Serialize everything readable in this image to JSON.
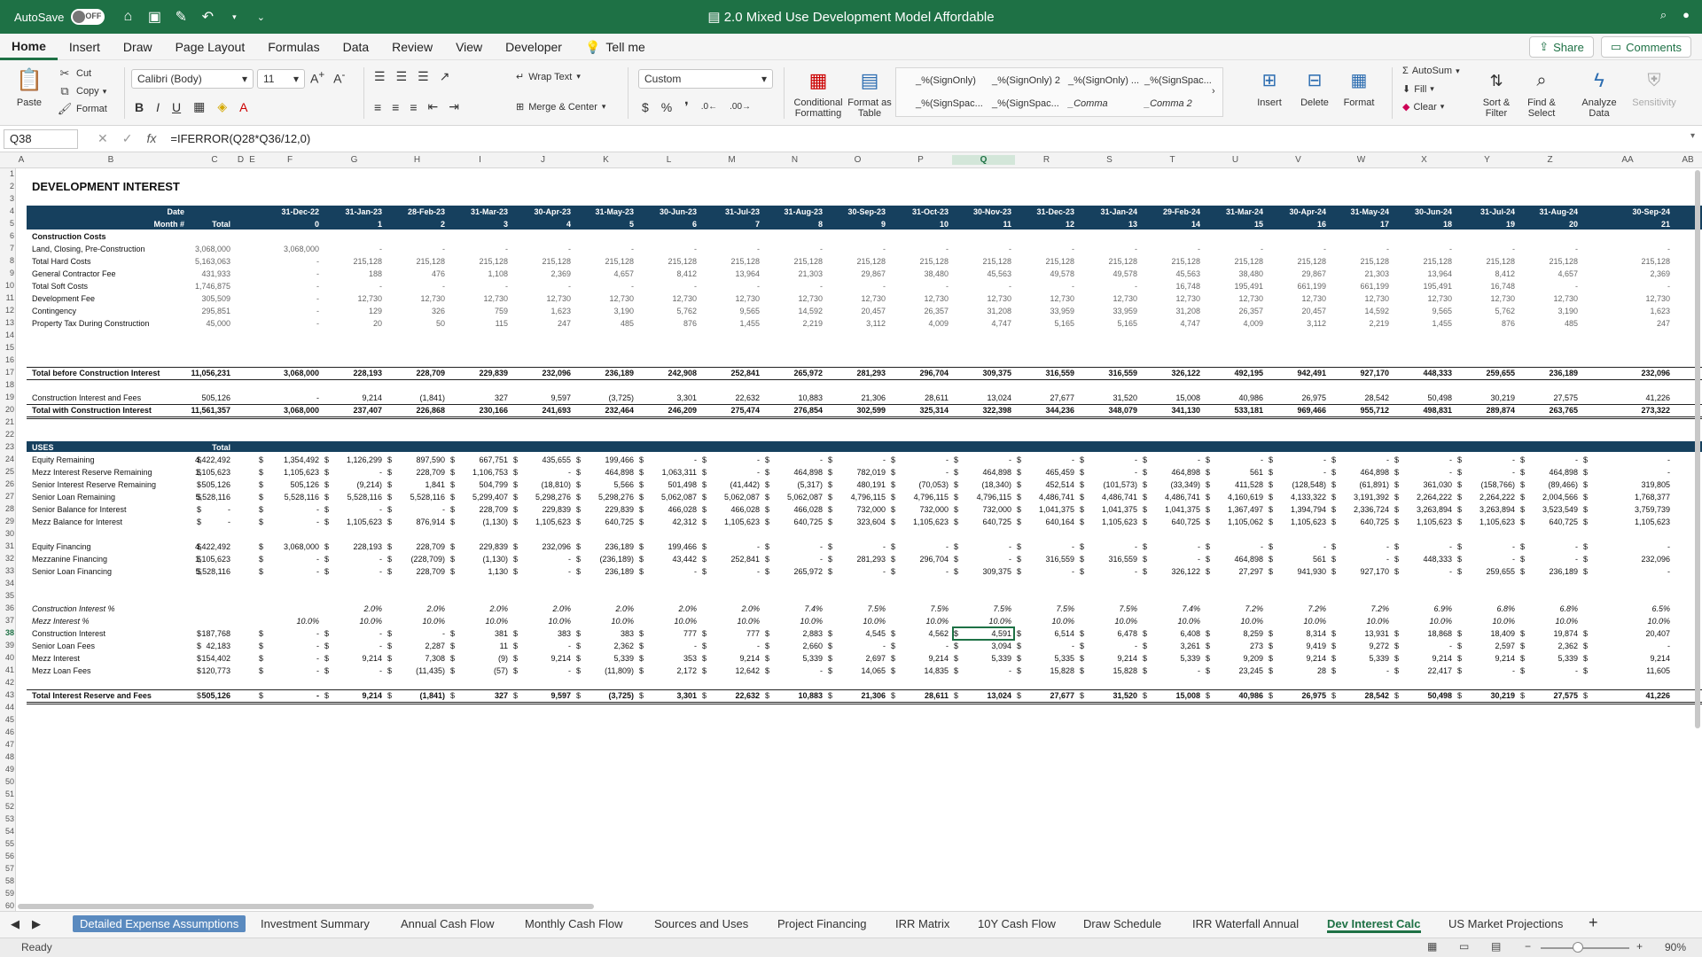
{
  "titlebar": {
    "autosave_label": "AutoSave",
    "toggle_state": "OFF",
    "doc_title": "2.0 Mixed Use Development Model Affordable"
  },
  "menu": {
    "tabs": [
      "Home",
      "Insert",
      "Draw",
      "Page Layout",
      "Formulas",
      "Data",
      "Review",
      "View",
      "Developer"
    ],
    "tell_me": "Tell me",
    "share": "Share",
    "comments": "Comments"
  },
  "ribbon": {
    "paste": "Paste",
    "cut": "Cut",
    "copy": "Copy",
    "format": "Format",
    "font_name": "Calibri (Body)",
    "font_size": "11",
    "wrap_text": "Wrap Text",
    "merge_center": "Merge & Center",
    "number_format": "Custom",
    "conditional_formatting": "Conditional Formatting",
    "format_as_table": "Format as Table",
    "styles": [
      "_%(SignOnly)",
      "_%(SignOnly) 2",
      "_%(SignOnly) ...",
      "_%(SignSpac...",
      "_%(SignSpac...",
      "_%(SignSpac...",
      "_Comma",
      "_Comma 2"
    ],
    "insert": "Insert",
    "delete": "Delete",
    "format_cells": "Format",
    "autosum": "AutoSum",
    "fill": "Fill",
    "clear": "Clear",
    "sort_filter": "Sort & Filter",
    "find_select": "Find & Select",
    "analyze_data": "Analyze Data",
    "sensitivity": "Sensitivity"
  },
  "formula_bar": {
    "name_box": "Q38",
    "fx": "fx",
    "formula": "=IFERROR(Q28*Q36/12,0)"
  },
  "columns": [
    "A",
    "B",
    "C",
    "D",
    "E",
    "F",
    "G",
    "H",
    "I",
    "J",
    "K",
    "L",
    "M",
    "N",
    "O",
    "P",
    "Q",
    "R",
    "S",
    "T",
    "U",
    "V",
    "W",
    "X",
    "Y",
    "Z",
    "AA",
    "AB"
  ],
  "sheet": {
    "title": "DEVELOPMENT INTEREST",
    "date_label": "Date",
    "month_label": "Month #",
    "total_label": "Total",
    "dates": [
      "31-Dec-22",
      "31-Jan-23",
      "28-Feb-23",
      "31-Mar-23",
      "30-Apr-23",
      "31-May-23",
      "30-Jun-23",
      "31-Jul-23",
      "31-Aug-23",
      "30-Sep-23",
      "31-Oct-23",
      "30-Nov-23",
      "31-Dec-23",
      "31-Jan-24",
      "29-Feb-24",
      "31-Mar-24",
      "30-Apr-24",
      "31-May-24",
      "30-Jun-24",
      "31-Jul-24",
      "31-Aug-24",
      "30-Sep-24"
    ],
    "months": [
      "0",
      "1",
      "2",
      "3",
      "4",
      "5",
      "6",
      "7",
      "8",
      "9",
      "10",
      "11",
      "12",
      "13",
      "14",
      "15",
      "16",
      "17",
      "18",
      "19",
      "20",
      "21"
    ],
    "construction_costs_label": "Construction Costs",
    "cost_rows": [
      {
        "label": "Land, Closing, Pre-Construction",
        "total": "3,068,000",
        "vals": [
          "3,068,000",
          "-",
          "-",
          "-",
          "-",
          "-",
          "-",
          "-",
          "-",
          "-",
          "-",
          "-",
          "-",
          "-",
          "-",
          "-",
          "-",
          "-",
          "-",
          "-",
          "-",
          "-"
        ]
      },
      {
        "label": "Total Hard Costs",
        "total": "5,163,063",
        "vals": [
          "-",
          "215,128",
          "215,128",
          "215,128",
          "215,128",
          "215,128",
          "215,128",
          "215,128",
          "215,128",
          "215,128",
          "215,128",
          "215,128",
          "215,128",
          "215,128",
          "215,128",
          "215,128",
          "215,128",
          "215,128",
          "215,128",
          "215,128",
          "215,128",
          "215,128"
        ]
      },
      {
        "label": "General Contractor Fee",
        "total": "431,933",
        "vals": [
          "-",
          "188",
          "476",
          "1,108",
          "2,369",
          "4,657",
          "8,412",
          "13,964",
          "21,303",
          "29,867",
          "38,480",
          "45,563",
          "49,578",
          "49,578",
          "45,563",
          "38,480",
          "29,867",
          "21,303",
          "13,964",
          "8,412",
          "4,657",
          "2,369"
        ]
      },
      {
        "label": "Total Soft Costs",
        "total": "1,746,875",
        "vals": [
          "-",
          "-",
          "-",
          "-",
          "-",
          "-",
          "-",
          "-",
          "-",
          "-",
          "-",
          "-",
          "-",
          "-",
          "16,748",
          "195,491",
          "661,199",
          "661,199",
          "195,491",
          "16,748",
          "-",
          "-"
        ]
      },
      {
        "label": "Development Fee",
        "total": "305,509",
        "vals": [
          "-",
          "12,730",
          "12,730",
          "12,730",
          "12,730",
          "12,730",
          "12,730",
          "12,730",
          "12,730",
          "12,730",
          "12,730",
          "12,730",
          "12,730",
          "12,730",
          "12,730",
          "12,730",
          "12,730",
          "12,730",
          "12,730",
          "12,730",
          "12,730",
          "12,730"
        ]
      },
      {
        "label": "Contingency",
        "total": "295,851",
        "vals": [
          "-",
          "129",
          "326",
          "759",
          "1,623",
          "3,190",
          "5,762",
          "9,565",
          "14,592",
          "20,457",
          "26,357",
          "31,208",
          "33,959",
          "33,959",
          "31,208",
          "26,357",
          "20,457",
          "14,592",
          "9,565",
          "5,762",
          "3,190",
          "1,623"
        ]
      },
      {
        "label": "Property Tax During Construction",
        "total": "45,000",
        "vals": [
          "-",
          "20",
          "50",
          "115",
          "247",
          "485",
          "876",
          "1,455",
          "2,219",
          "3,112",
          "4,009",
          "4,747",
          "5,165",
          "5,165",
          "4,747",
          "4,009",
          "3,112",
          "2,219",
          "1,455",
          "876",
          "485",
          "247"
        ]
      }
    ],
    "total_before": {
      "label": "Total before Construction Interest",
      "total": "11,056,231",
      "vals": [
        "3,068,000",
        "228,193",
        "228,709",
        "229,839",
        "232,096",
        "236,189",
        "242,908",
        "252,841",
        "265,972",
        "281,293",
        "296,704",
        "309,375",
        "316,559",
        "316,559",
        "326,122",
        "492,195",
        "942,491",
        "927,170",
        "448,333",
        "259,655",
        "236,189",
        "232,096"
      ]
    },
    "ci_fees": {
      "label": "Construction Interest and Fees",
      "total": "505,126",
      "vals": [
        "-",
        "9,214",
        "(1,841)",
        "327",
        "9,597",
        "(3,725)",
        "3,301",
        "22,632",
        "10,883",
        "21,306",
        "28,611",
        "13,024",
        "27,677",
        "31,520",
        "15,008",
        "40,986",
        "26,975",
        "28,542",
        "50,498",
        "30,219",
        "27,575",
        "41,226"
      ]
    },
    "total_with": {
      "label": "Total with Construction Interest",
      "total": "11,561,357",
      "vals": [
        "3,068,000",
        "237,407",
        "226,868",
        "230,166",
        "241,693",
        "232,464",
        "246,209",
        "275,474",
        "276,854",
        "302,599",
        "325,314",
        "322,398",
        "344,236",
        "348,079",
        "341,130",
        "533,181",
        "969,466",
        "955,712",
        "498,831",
        "289,874",
        "263,765",
        "273,322"
      ]
    },
    "uses_label": "USES",
    "uses_total_label": "Total",
    "uses_rows": [
      {
        "label": "Equity Remaining",
        "total": "4,422,492",
        "vals": [
          "1,354,492",
          "1,126,299",
          "897,590",
          "667,751",
          "435,655",
          "199,466",
          "-",
          "-",
          "-",
          "-",
          "-",
          "-",
          "-",
          "-",
          "-",
          "-",
          "-",
          "-",
          "-",
          "-",
          "-",
          "-"
        ]
      },
      {
        "label": "Mezz Interest Reserve  Remaining",
        "total": "1,105,623",
        "vals": [
          "1,105,623",
          "-",
          "228,709",
          "1,106,753",
          "-",
          "464,898",
          "1,063,311",
          "-",
          "464,898",
          "782,019",
          "-",
          "464,898",
          "465,459",
          "-",
          "464,898",
          "561",
          "-",
          "464,898",
          "-",
          "-",
          "464,898",
          "-"
        ]
      },
      {
        "label": "Senior Interest Reserve Remaining",
        "total": "505,126",
        "vals": [
          "505,126",
          "(9,214)",
          "1,841",
          "504,799",
          "(18,810)",
          "5,566",
          "501,498",
          "(41,442)",
          "(5,317)",
          "480,191",
          "(70,053)",
          "(18,340)",
          "452,514",
          "(101,573)",
          "(33,349)",
          "411,528",
          "(128,548)",
          "(61,891)",
          "361,030",
          "(158,766)",
          "(89,466)",
          "319,805"
        ]
      },
      {
        "label": "Senior Loan Remaining",
        "total": "5,528,116",
        "vals": [
          "5,528,116",
          "5,528,116",
          "5,528,116",
          "5,299,407",
          "5,298,276",
          "5,298,276",
          "5,062,087",
          "5,062,087",
          "5,062,087",
          "4,796,115",
          "4,796,115",
          "4,796,115",
          "4,486,741",
          "4,486,741",
          "4,486,741",
          "4,160,619",
          "4,133,322",
          "3,191,392",
          "2,264,222",
          "2,264,222",
          "2,004,566",
          "1,768,377"
        ]
      },
      {
        "label": "Senior Balance for Interest",
        "total": "-",
        "vals": [
          "-",
          "-",
          "-",
          "228,709",
          "229,839",
          "229,839",
          "466,028",
          "466,028",
          "466,028",
          "732,000",
          "732,000",
          "732,000",
          "1,041,375",
          "1,041,375",
          "1,041,375",
          "1,367,497",
          "1,394,794",
          "2,336,724",
          "3,263,894",
          "3,263,894",
          "3,523,549",
          "3,759,739"
        ]
      },
      {
        "label": "Mezz Balance for Interest",
        "total": "-",
        "vals": [
          "-",
          "1,105,623",
          "876,914",
          "(1,130)",
          "1,105,623",
          "640,725",
          "42,312",
          "1,105,623",
          "640,725",
          "323,604",
          "1,105,623",
          "640,725",
          "640,164",
          "1,105,623",
          "640,725",
          "1,105,062",
          "1,105,623",
          "640,725",
          "1,105,623",
          "1,105,623",
          "640,725",
          "1,105,623"
        ]
      }
    ],
    "fin_rows": [
      {
        "label": "Equity Financing",
        "total": "4,422,492",
        "vals": [
          "3,068,000",
          "228,193",
          "228,709",
          "229,839",
          "232,096",
          "236,189",
          "199,466",
          "-",
          "-",
          "-",
          "-",
          "-",
          "-",
          "-",
          "-",
          "-",
          "-",
          "-",
          "-",
          "-",
          "-",
          "-"
        ]
      },
      {
        "label": "Mezzanine Financing",
        "total": "1,105,623",
        "vals": [
          "-",
          "-",
          "(228,709)",
          "(1,130)",
          "-",
          "(236,189)",
          "43,442",
          "252,841",
          "-",
          "281,293",
          "296,704",
          "-",
          "316,559",
          "316,559",
          "-",
          "464,898",
          "561",
          "-",
          "448,333",
          "-",
          "-",
          "232,096"
        ]
      },
      {
        "label": "Senior Loan Financing",
        "total": "5,528,116",
        "vals": [
          "-",
          "-",
          "228,709",
          "1,130",
          "-",
          "236,189",
          "-",
          "-",
          "265,972",
          "-",
          "-",
          "309,375",
          "-",
          "-",
          "326,122",
          "27,297",
          "941,930",
          "927,170",
          "-",
          "259,655",
          "236,189",
          "-"
        ]
      }
    ],
    "rate_rows": [
      {
        "label": "Construction Interest %",
        "vals": [
          "",
          "2.0%",
          "2.0%",
          "2.0%",
          "2.0%",
          "2.0%",
          "2.0%",
          "2.0%",
          "7.4%",
          "7.5%",
          "7.5%",
          "7.5%",
          "7.5%",
          "7.5%",
          "7.4%",
          "7.2%",
          "7.2%",
          "7.2%",
          "6.9%",
          "6.8%",
          "6.8%",
          "6.5%"
        ]
      },
      {
        "label": "Mezz Interest %",
        "vals": [
          "10.0%",
          "10.0%",
          "10.0%",
          "10.0%",
          "10.0%",
          "10.0%",
          "10.0%",
          "10.0%",
          "10.0%",
          "10.0%",
          "10.0%",
          "10.0%",
          "10.0%",
          "10.0%",
          "10.0%",
          "10.0%",
          "10.0%",
          "10.0%",
          "10.0%",
          "10.0%",
          "10.0%",
          "10.0%"
        ]
      }
    ],
    "interest_rows": [
      {
        "label": "Construction Interest",
        "total": "187,768",
        "vals": [
          "-",
          "-",
          "-",
          "381",
          "383",
          "383",
          "777",
          "777",
          "2,883",
          "4,545",
          "4,562",
          "4,591",
          "6,514",
          "6,478",
          "6,408",
          "8,259",
          "8,314",
          "13,931",
          "18,868",
          "18,409",
          "19,874",
          "20,407"
        ]
      },
      {
        "label": "Senior Loan Fees",
        "total": "42,183",
        "vals": [
          "-",
          "-",
          "2,287",
          "11",
          "-",
          "2,362",
          "-",
          "-",
          "2,660",
          "-",
          "-",
          "3,094",
          "-",
          "-",
          "3,261",
          "273",
          "9,419",
          "9,272",
          "-",
          "2,597",
          "2,362",
          "-"
        ]
      },
      {
        "label": "Mezz Interest",
        "total": "154,402",
        "vals": [
          "-",
          "9,214",
          "7,308",
          "(9)",
          "9,214",
          "5,339",
          "353",
          "9,214",
          "5,339",
          "2,697",
          "9,214",
          "5,339",
          "5,335",
          "9,214",
          "5,339",
          "9,209",
          "9,214",
          "5,339",
          "9,214",
          "9,214",
          "5,339",
          "9,214"
        ]
      },
      {
        "label": "Mezz Loan Fees",
        "total": "120,773",
        "vals": [
          "-",
          "-",
          "(11,435)",
          "(57)",
          "-",
          "(11,809)",
          "2,172",
          "12,642",
          "-",
          "14,065",
          "14,835",
          "-",
          "15,828",
          "15,828",
          "-",
          "23,245",
          "28",
          "-",
          "22,417",
          "-",
          "-",
          "11,605"
        ]
      }
    ],
    "total_interest": {
      "label": "Total Interest Reserve and Fees",
      "total": "505,126",
      "vals": [
        "-",
        "9,214",
        "(1,841)",
        "327",
        "9,597",
        "(3,725)",
        "3,301",
        "22,632",
        "10,883",
        "21,306",
        "28,611",
        "13,024",
        "27,677",
        "31,520",
        "15,008",
        "40,986",
        "26,975",
        "28,542",
        "50,498",
        "30,219",
        "27,575",
        "41,226"
      ]
    }
  },
  "sheet_tabs": [
    "Detailed Expense Assumptions",
    "Investment Summary",
    "Annual Cash Flow",
    "Monthly Cash Flow",
    "Sources and Uses",
    "Project Financing",
    "IRR Matrix",
    "10Y Cash Flow",
    "Draw Schedule",
    "IRR Waterfall Annual",
    "Dev Interest Calc",
    "US Market Projections"
  ],
  "active_sheet": "Dev Interest Calc",
  "status": {
    "ready": "Ready",
    "zoom": "90%"
  }
}
